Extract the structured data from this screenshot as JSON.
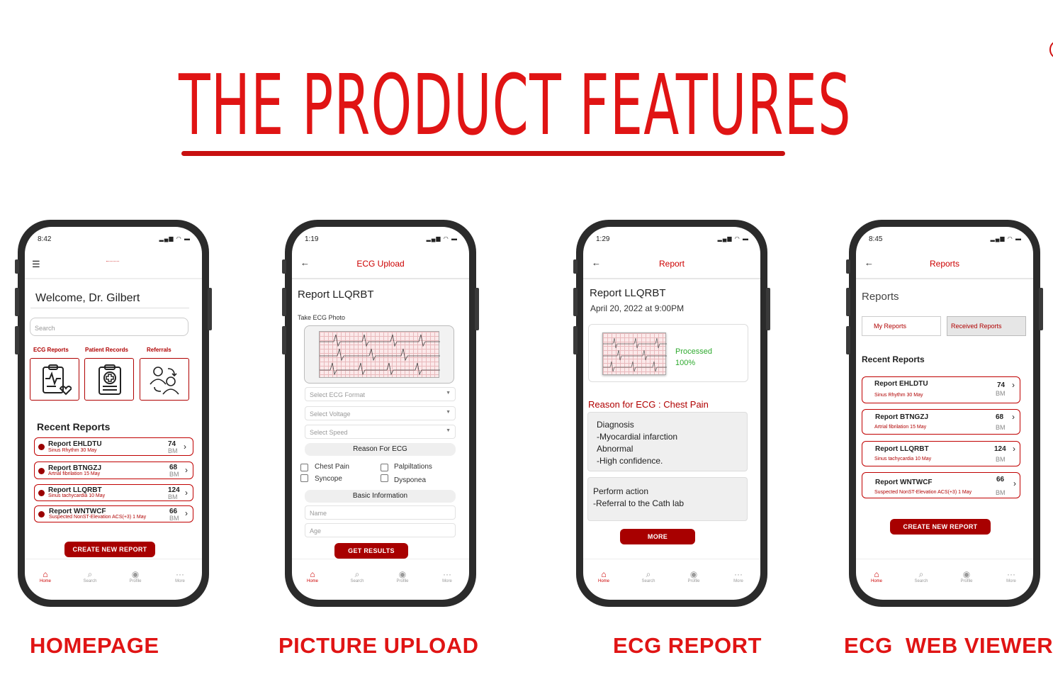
{
  "title": "THE PRODUCT FEATURES",
  "accent": "#e01414",
  "captions": [
    "HOMEPAGE",
    "PICTURE UPLOAD",
    "ECG REPORT",
    "ECG  WEB VIEWER"
  ],
  "nav": [
    "Home",
    "Search",
    "Profile",
    "More"
  ],
  "home": {
    "time": "8:42",
    "welcome": "Welcome, Dr. Gilbert",
    "search_placeholder": "Search",
    "tiles": [
      "ECG Reports",
      "Patient Records",
      "Referrals"
    ],
    "recent_title": "Recent Reports",
    "reports": [
      {
        "name": "Report EHLDTU",
        "sub": "Sinus Rhythm  30 May",
        "value": "74",
        "unit": "BM"
      },
      {
        "name": "Report BTNGZJ",
        "sub": "Artrial fibrilation 15 May",
        "value": "68",
        "unit": "BM"
      },
      {
        "name": "Report LLQRBT",
        "sub": "Sinus tachycardia 10 May",
        "value": "124",
        "unit": "BM"
      },
      {
        "name": "Report WNTWCF",
        "sub": "Suspected NonST-Elevation ACS(+3) 1 May",
        "value": "66",
        "unit": "BM"
      }
    ],
    "create_button": "CREATE NEW REPORT"
  },
  "upload": {
    "time": "1:19",
    "appbar_title": "ECG Upload",
    "report_title": "Report LLQRBT",
    "photo_label": "Take ECG Photo",
    "dropdowns": [
      "Select ECG Format",
      "Select Voltage",
      "Select Speed"
    ],
    "reason_header": "Reason For ECG",
    "checkboxes": [
      "Chest Pain",
      "Palpiltations",
      "Syncope",
      "Dysponea"
    ],
    "basic_header": "Basic Information",
    "fields": [
      "Name",
      "Age"
    ],
    "results_button": "GET RESULTS"
  },
  "report": {
    "time": "1:29",
    "appbar_title": "Report",
    "report_title": "Report LLQRBT",
    "datetime": "April 20, 2022 at 9:00PM",
    "status": "Processed",
    "progress": "100%",
    "reason": "Reason for ECG : Chest Pain",
    "diagnosis": [
      "Diagnosis",
      "-Myocardial infarction",
      "Abnormal",
      "-High confidence."
    ],
    "action": [
      "Perform action",
      "-Referral to the Cath lab"
    ],
    "more_button": "MORE"
  },
  "viewer": {
    "time": "8:45",
    "appbar_title": "Reports",
    "heading": "Reports",
    "tabs": [
      "My Reports",
      "Received Reports"
    ],
    "recent_title": "Recent Reports",
    "reports": [
      {
        "name": "Report EHLDTU",
        "sub": "Sinus Rhythm  30 May",
        "value": "74",
        "unit": "BM"
      },
      {
        "name": "Report BTNGZJ",
        "sub": "Artrial fibrilation 15 May",
        "value": "68",
        "unit": "BM"
      },
      {
        "name": "Report LLQRBT",
        "sub": "Sinus tachycardia 10 May",
        "value": "124",
        "unit": "BM"
      },
      {
        "name": "Report WNTWCF",
        "sub": "Suspected NonST-Elevation ACS(+3) 1 May",
        "value": "66",
        "unit": "BM"
      }
    ],
    "create_button": "CREATE NEW REPORT"
  }
}
